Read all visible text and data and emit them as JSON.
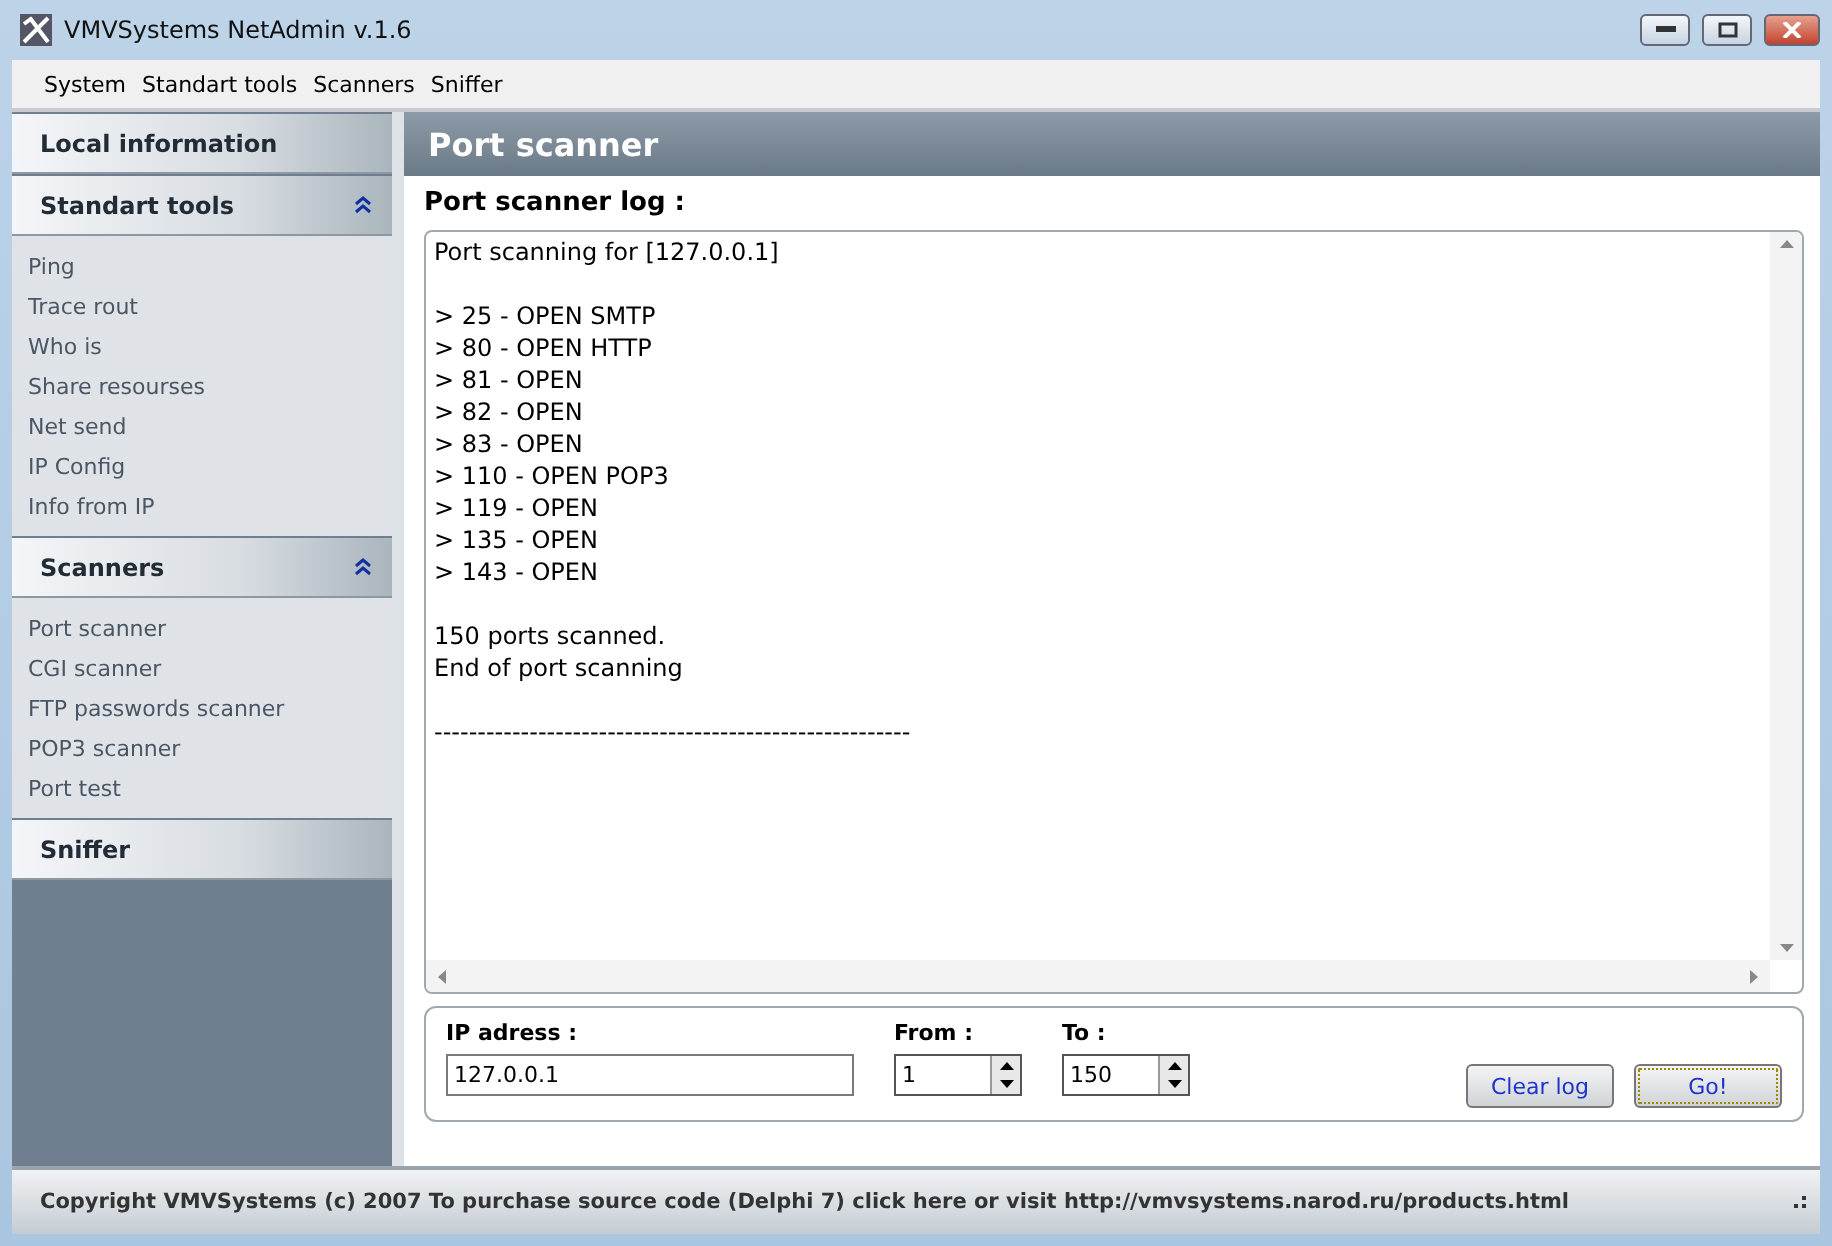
{
  "window": {
    "title": "VMVSystems NetAdmin v.1.6"
  },
  "menu": [
    "System",
    "Standart tools",
    "Scanners",
    "Sniffer"
  ],
  "sidebar": {
    "sections": [
      {
        "title": "Local information",
        "expanded": false
      },
      {
        "title": "Standart tools",
        "expanded": true,
        "items": [
          "Ping",
          "Trace rout",
          "Who is",
          "Share resourses",
          "Net send",
          "IP Config",
          "Info from IP"
        ]
      },
      {
        "title": "Scanners",
        "expanded": true,
        "items": [
          "Port scanner",
          "CGI scanner",
          "FTP passwords scanner",
          "POP3 scanner",
          "Port test"
        ]
      },
      {
        "title": "Sniffer",
        "expanded": false
      }
    ]
  },
  "panel": {
    "title": "Port scanner",
    "log_label": "Port scanner log :",
    "log_blocks": [
      [
        "Port scanning for [127.0.0.1]"
      ],
      [
        "> 25 - OPEN SMTP",
        "> 80 - OPEN HTTP",
        "> 81 - OPEN",
        "> 82 - OPEN",
        "> 83 - OPEN",
        "> 110 - OPEN POP3",
        "> 119 - OPEN",
        "> 135 - OPEN",
        "> 143 - OPEN"
      ],
      [
        "150 ports scanned.",
        "End of port scanning"
      ],
      [
        "-------------------------------------------------------"
      ]
    ],
    "fields": [
      {
        "label": "IP adress :",
        "value": "127.0.0.1",
        "kind": "text"
      },
      {
        "label": "From :",
        "value": "1",
        "kind": "spin"
      },
      {
        "label": "To :",
        "value": "150",
        "kind": "spin"
      }
    ],
    "buttons": [
      {
        "label": "Clear log",
        "focused": false
      },
      {
        "label": "Go!",
        "focused": true
      }
    ]
  },
  "status_bar": "Copyright VMVSystems (c) 2007  To purchase source code (Delphi 7) click here or visit http://vmvsystems.narod.ru/products.html"
}
